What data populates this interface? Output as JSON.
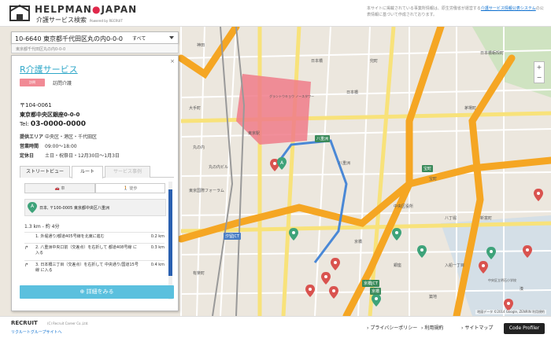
{
  "header": {
    "brand_part1": "HELPMAN",
    "brand_part2": "JAPAN",
    "subtitle": "介護サービス検索",
    "powered": "Powered by RECRUIT",
    "notice_text": "本サイトに掲載されている事業所情報は、原生労働省が運営する",
    "notice_link1": "介護サービス情報公表システム",
    "notice_text2": "の公表情報に基づいて作成されております。"
  },
  "search": {
    "value": "10-6640  東京都千代田区丸の内0-0-0",
    "scope": "すべて",
    "suggestion": "東京都千代田区丸の内0-0-0"
  },
  "facility": {
    "name": "R介護サービス",
    "badge": "訪問",
    "service_type": "訪問介護",
    "postal": "〒104-0061",
    "address": "東京都中央区銀座0-0-0",
    "tel_label": "Tel: ",
    "tel": "03-0000-0000",
    "area_label": "提供エリア",
    "area": "中央区・港区・千代田区",
    "hours_label": "営業時間",
    "hours": "09:00～18:00",
    "closed_label": "定休日",
    "closed": "土日・祝祭日・12月30日～1月3日"
  },
  "tabs": [
    {
      "label": "ストリートビュー"
    },
    {
      "label": "ルート"
    },
    {
      "label": "サービス事例"
    }
  ],
  "modes": {
    "car": "車",
    "walk": "徒歩"
  },
  "route": {
    "origin": "日本, 〒100-0005 東京都中央区八重洲",
    "summary": "1.3 km - 約 4分",
    "steps": [
      {
        "num": "1.",
        "text": "外堀通り/都道405号線を北東に進む",
        "dist": "0.2 km",
        "dir": ""
      },
      {
        "num": "2.",
        "text": "八重洲中央口前（交差点）を右折して 都道408号線 に入る",
        "dist": "0.3 km",
        "dir": "↱"
      },
      {
        "num": "3.",
        "text": "日本橋三丁目（交差点）を右折して 中央通り/国道15号線 に入る",
        "dist": "0.4 km",
        "dir": "↱"
      }
    ]
  },
  "details_button": "詳細をみる",
  "map": {
    "copyright": "地図データ ©2014 Google, ZENRIN  利用規約",
    "labels": [
      "神田",
      "大手町",
      "丸の内",
      "東京駅",
      "グラントウキョウ ノースタワー",
      "日本橋",
      "八重洲",
      "京橋",
      "宝町",
      "茅場町",
      "新富町",
      "八丁堀",
      "築地",
      "銀座",
      "有楽町",
      "東京国際フォーラム",
      "兜町",
      "中央区役所",
      "入船一丁目",
      "湊",
      "日本橋蛎殻町",
      "丸の内ビル",
      "日本橋",
      "中央区立明石小学校"
    ],
    "signs": [
      "八重洲",
      "宝町",
      "京橋JCT",
      "京橋",
      "汐留JCT"
    ],
    "colors": {
      "expressway": "#f5a623",
      "marker_red": "#d9534f",
      "marker_green": "#3ea37a",
      "route": "#4a88d6"
    }
  },
  "footer": {
    "company": "RECRUIT",
    "copyright": "(C) Recruit Career Co.,Ltd.",
    "group_link": "リクルートグループサイトへ",
    "links": [
      "プライバシーポリシー",
      "利用規約",
      "サイトマップ"
    ],
    "code_profiler": "Code Profiler"
  }
}
